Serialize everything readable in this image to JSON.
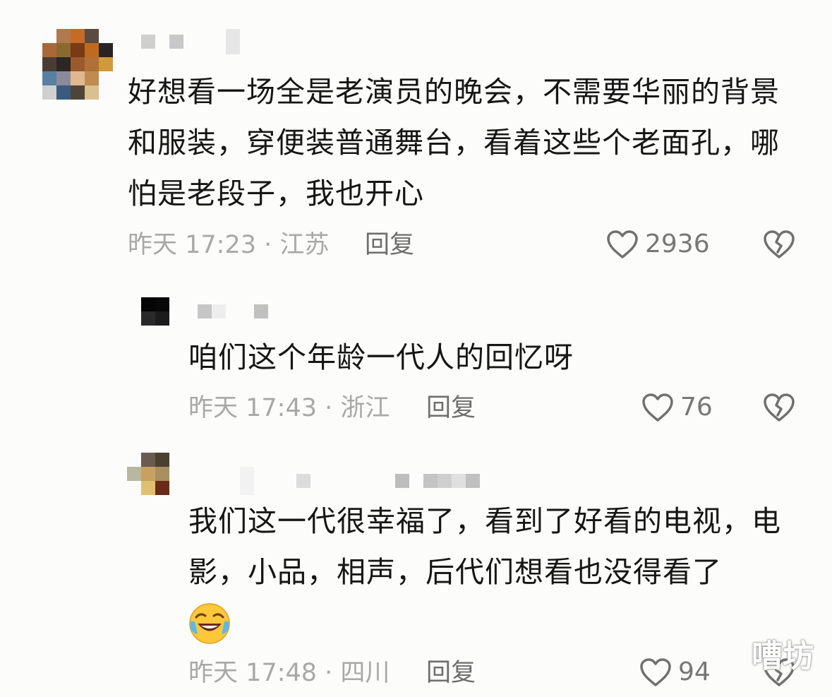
{
  "comments": [
    {
      "text": "好想看一场全是老演员的晚会，不需要华丽的背景和服装，穿便装普通舞台，看着这些个老面孔，哪怕是老段子，我也开心",
      "time": "昨天 17:23 · 江苏",
      "reply_label": "回复",
      "likes": "2936"
    },
    {
      "text": "咱们这个年龄一代人的回忆呀",
      "time": "昨天 17:43 · 浙江",
      "reply_label": "回复",
      "likes": "76"
    },
    {
      "text": "我们这一代很幸福了，看到了好看的电视，电影，小品，相声，后代们想看也没得看了",
      "emoji": "laughing-crying-emoji",
      "time": "昨天 17:48 · 四川",
      "reply_label": "回复",
      "likes": "94"
    }
  ],
  "icons": {
    "like": "heart-outline-icon",
    "dislike": "broken-heart-icon"
  },
  "watermark": "嘈坊",
  "colors": {
    "text": "#161616",
    "meta": "#a8a8a8",
    "reply": "#6e6e6e",
    "icon": "#707070"
  }
}
